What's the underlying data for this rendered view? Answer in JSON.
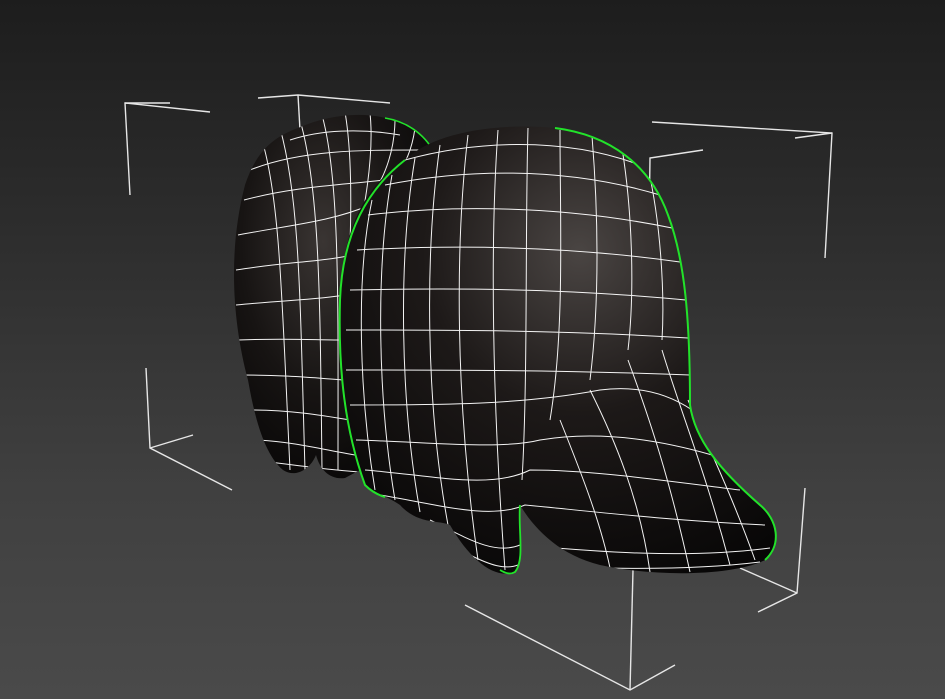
{
  "viewport": {
    "background_top": "#1d1d1d",
    "background_bottom": "#4a4a4a",
    "selection_bracket_color": "#e8e8e8",
    "wireframe_color": "#ffffff",
    "selected_edge_color": "#22e22a",
    "mesh_shading_color": "#0f0d0c"
  },
  "object": {
    "description_icon": "mesh-object",
    "selected": true
  }
}
